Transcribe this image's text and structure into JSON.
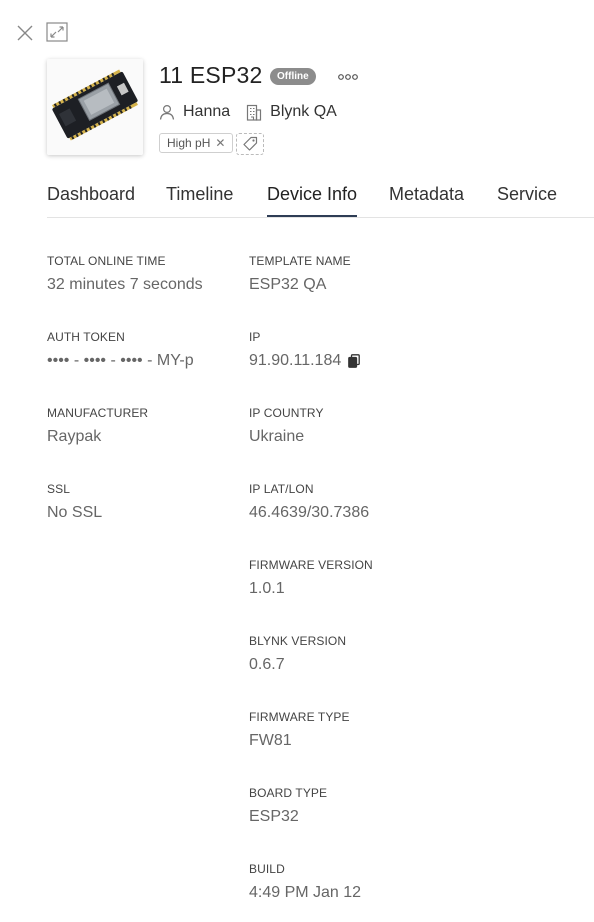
{
  "device": {
    "name": "11 ESP32",
    "status": "Offline",
    "owner": "Hanna",
    "organization": "Blynk QA",
    "tags": [
      "High pH"
    ]
  },
  "tabs": [
    "Dashboard",
    "Timeline",
    "Device Info",
    "Metadata",
    "Service"
  ],
  "active_tab": "Device Info",
  "info_left": [
    {
      "label": "TOTAL ONLINE TIME",
      "value": "32 minutes 7 seconds"
    },
    {
      "label": "AUTH TOKEN",
      "value": "•••• - •••• - •••• - MY-p"
    },
    {
      "label": "MANUFACTURER",
      "value": "Raypak"
    },
    {
      "label": "SSL",
      "value": "No SSL"
    }
  ],
  "info_right": [
    {
      "label": "TEMPLATE NAME",
      "value": "ESP32 QA"
    },
    {
      "label": "IP",
      "value": "91.90.11.184"
    },
    {
      "label": "IP COUNTRY",
      "value": "Ukraine"
    },
    {
      "label": "IP LAT/LON",
      "value": "46.4639/30.7386"
    },
    {
      "label": "FIRMWARE VERSION",
      "value": "1.0.1"
    },
    {
      "label": "BLYNK VERSION",
      "value": "0.6.7"
    },
    {
      "label": "FIRMWARE TYPE",
      "value": "FW81"
    },
    {
      "label": "BOARD TYPE",
      "value": "ESP32"
    },
    {
      "label": "BUILD",
      "value": "4:49 PM Jan 12"
    }
  ],
  "icons": {
    "close": "close-icon",
    "expand": "expand-icon",
    "more": "more-options-icon",
    "user": "user-icon",
    "organization": "building-icon",
    "tag_add": "tag-icon",
    "copy": "copy-icon"
  },
  "colors": {
    "badge_bg": "#8c8c8c",
    "active_tab_underline": "#2e3d55",
    "text": "#333333",
    "value_text": "#666666"
  }
}
